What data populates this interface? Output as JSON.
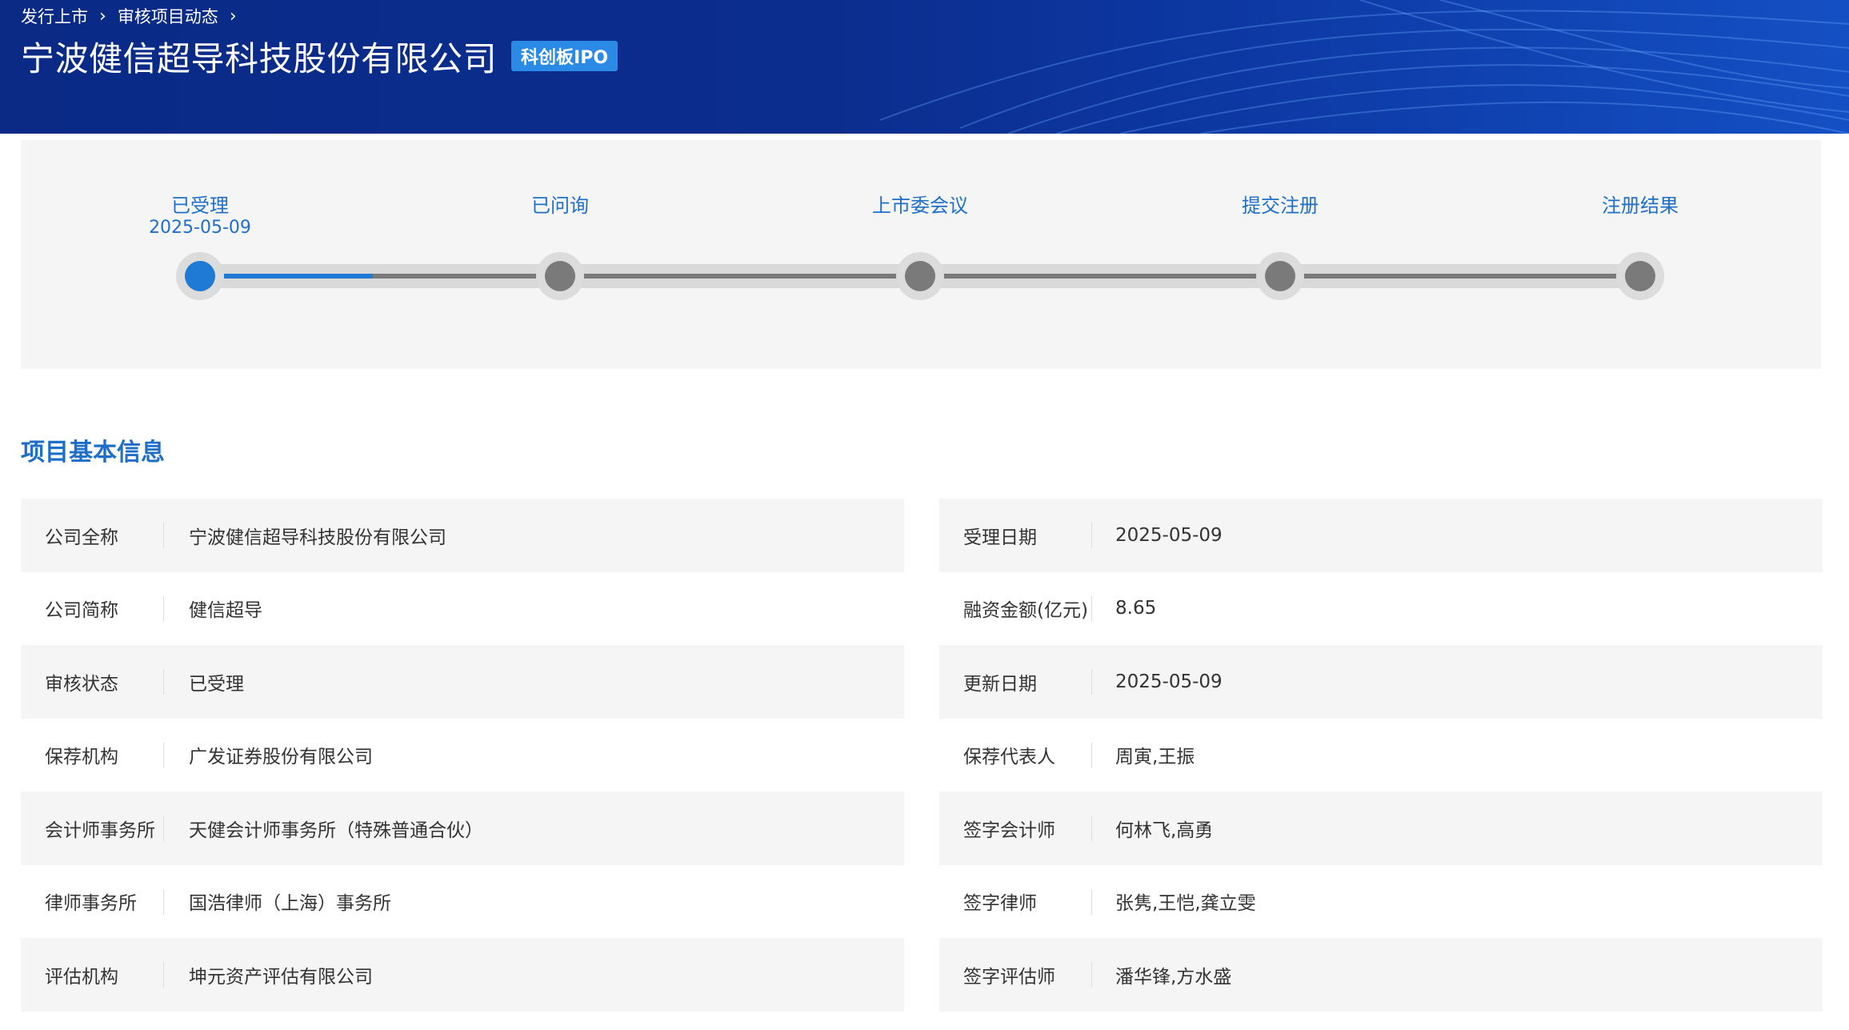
{
  "breadcrumb": [
    {
      "label": "发行上市"
    },
    {
      "label": "审核项目动态"
    }
  ],
  "header": {
    "title": "宁波健信超导科技股份有限公司",
    "badge": "科创板IPO"
  },
  "progress": {
    "completed_fraction": 0.12,
    "steps": [
      {
        "label": "已受理",
        "date": "2025-05-09",
        "active": true
      },
      {
        "label": "已问询",
        "date": "",
        "active": false
      },
      {
        "label": "上市委会议",
        "date": "",
        "active": false
      },
      {
        "label": "提交注册",
        "date": "",
        "active": false
      },
      {
        "label": "注册结果",
        "date": "",
        "active": false
      }
    ]
  },
  "section": {
    "title": "项目基本信息"
  },
  "info": {
    "left": [
      {
        "key": "公司全称",
        "value": "宁波健信超导科技股份有限公司"
      },
      {
        "key": "公司简称",
        "value": "健信超导"
      },
      {
        "key": "审核状态",
        "value": "已受理"
      },
      {
        "key": "保荐机构",
        "value": "广发证券股份有限公司"
      },
      {
        "key": "会计师事务所",
        "value": "天健会计师事务所（特殊普通合伙）"
      },
      {
        "key": "律师事务所",
        "value": "国浩律师（上海）事务所"
      },
      {
        "key": "评估机构",
        "value": "坤元资产评估有限公司"
      }
    ],
    "right": [
      {
        "key": "受理日期",
        "value": "2025-05-09"
      },
      {
        "key": "融资金额(亿元)",
        "value": "8.65"
      },
      {
        "key": "更新日期",
        "value": "2025-05-09"
      },
      {
        "key": "保荐代表人",
        "value": "周寅,王振"
      },
      {
        "key": "签字会计师",
        "value": "何林飞,高勇"
      },
      {
        "key": "签字律师",
        "value": "张隽,王恺,龚立雯"
      },
      {
        "key": "签字评估师",
        "value": "潘华锋,方水盛"
      }
    ]
  },
  "colors": {
    "banner": "#0b2d8e",
    "accent": "#1f6fc9",
    "badge": "#2b8ae6",
    "panel": "#f5f5f5"
  }
}
